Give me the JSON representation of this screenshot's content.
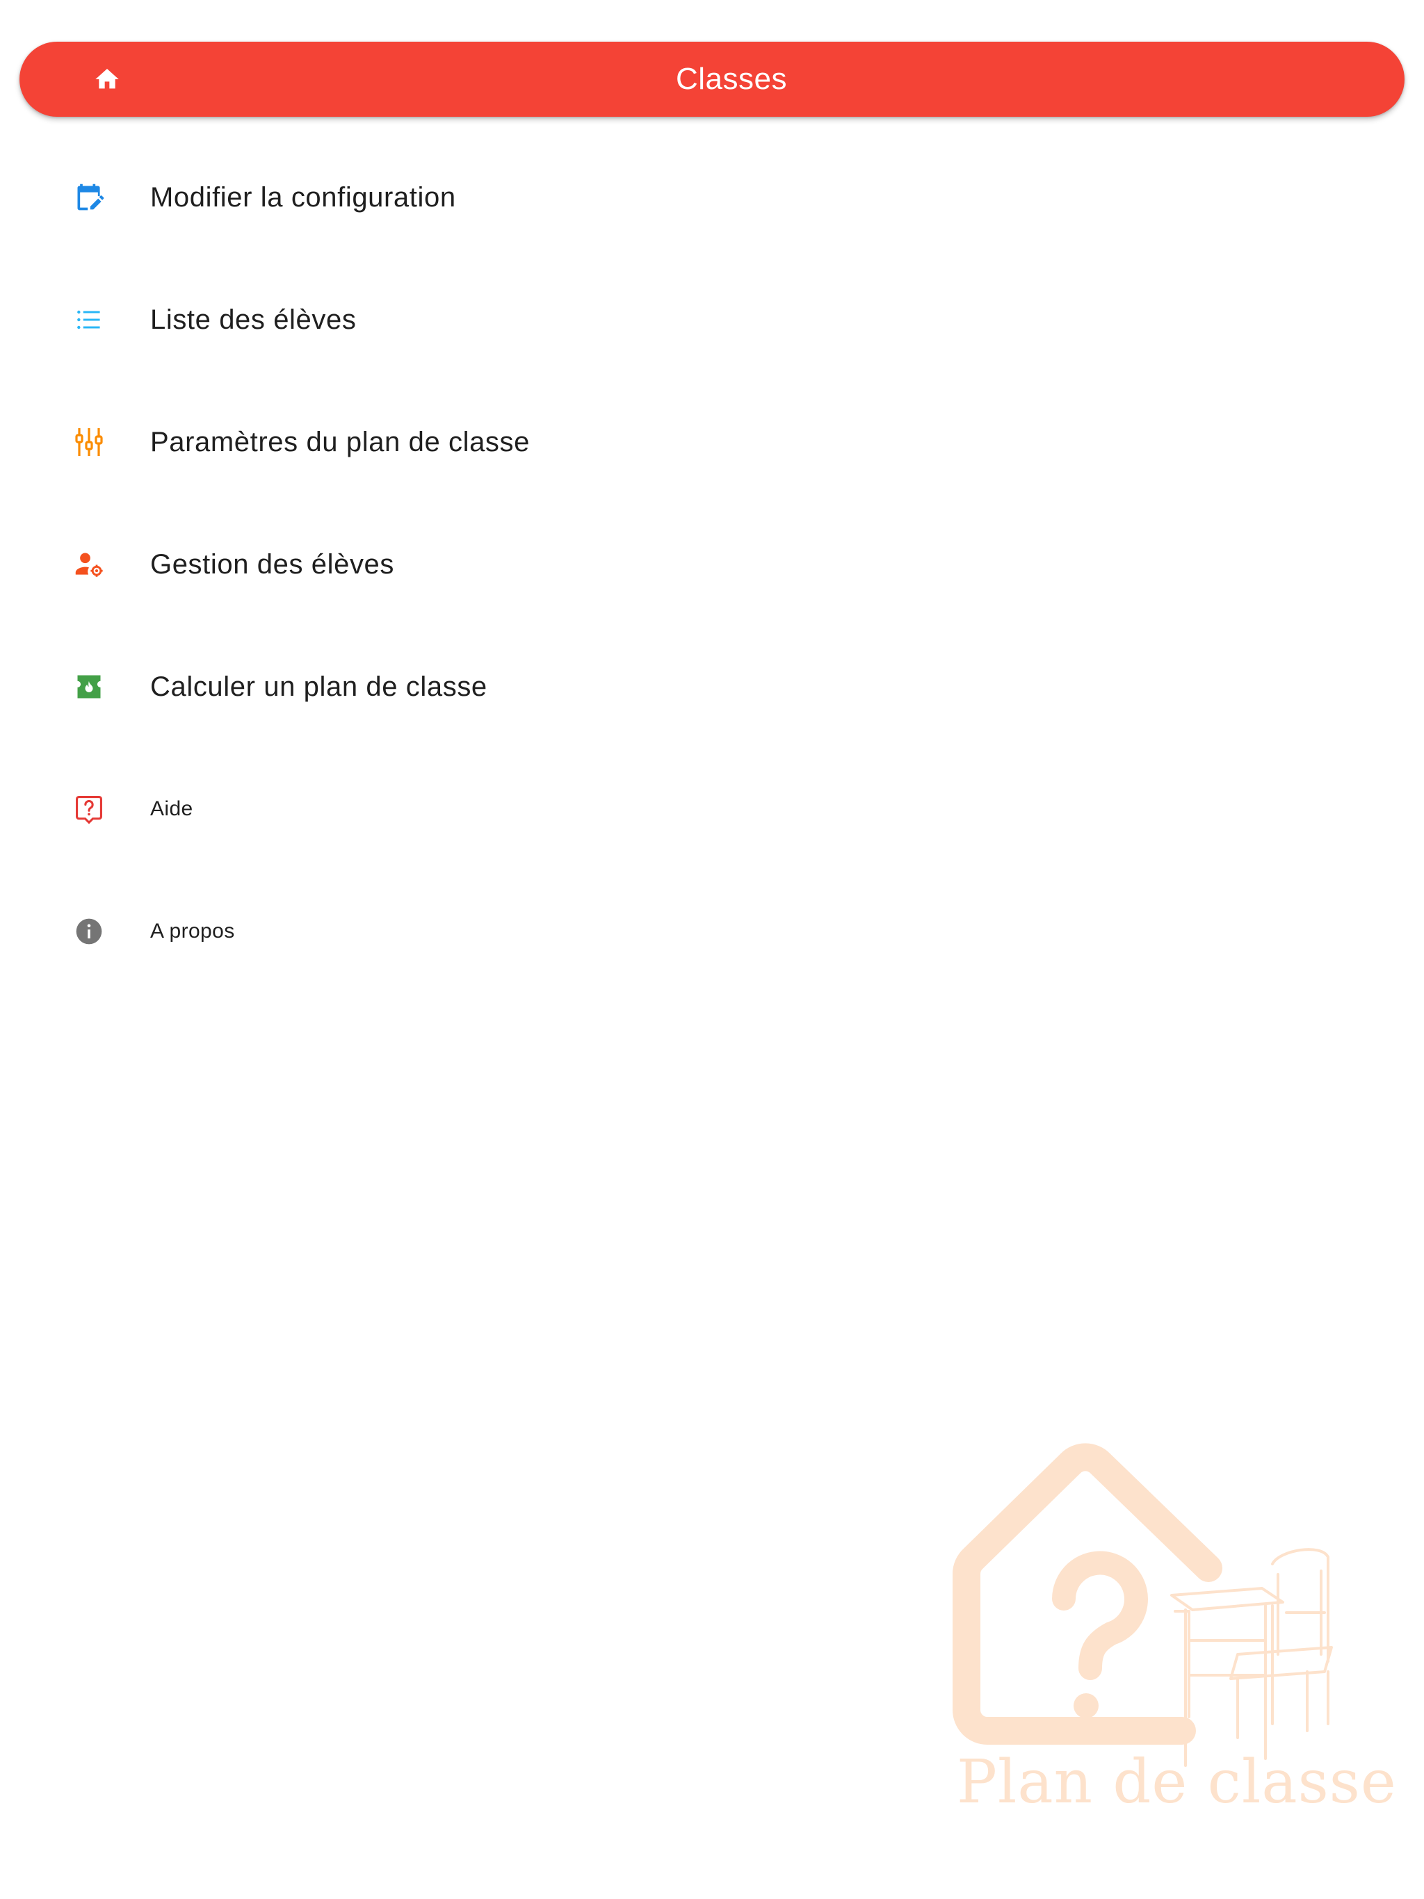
{
  "app_bar": {
    "title": "Classes",
    "home_icon": "home-icon",
    "color": "#f44336"
  },
  "menu": {
    "items": [
      {
        "label": "Modifier la configuration",
        "icon": "calendar-edit-icon",
        "icon_color": "#1e88e5"
      },
      {
        "label": "Liste des élèves",
        "icon": "list-icon",
        "icon_color": "#29b6f6"
      },
      {
        "label": "Paramètres du plan de classe",
        "icon": "sliders-icon",
        "icon_color": "#fb8c00"
      },
      {
        "label": "Gestion des élèves",
        "icon": "user-settings-icon",
        "icon_color": "#f4511e"
      },
      {
        "label": "Calculer un plan de classe",
        "icon": "calculate-icon",
        "icon_color": "#43a047"
      },
      {
        "label": "Aide",
        "icon": "help-icon",
        "icon_color": "#e53935"
      },
      {
        "label": "A propos",
        "icon": "info-icon",
        "icon_color": "#757575"
      }
    ]
  },
  "watermark": {
    "logo_text": "Plan de classe",
    "color": "#fde2cc"
  }
}
